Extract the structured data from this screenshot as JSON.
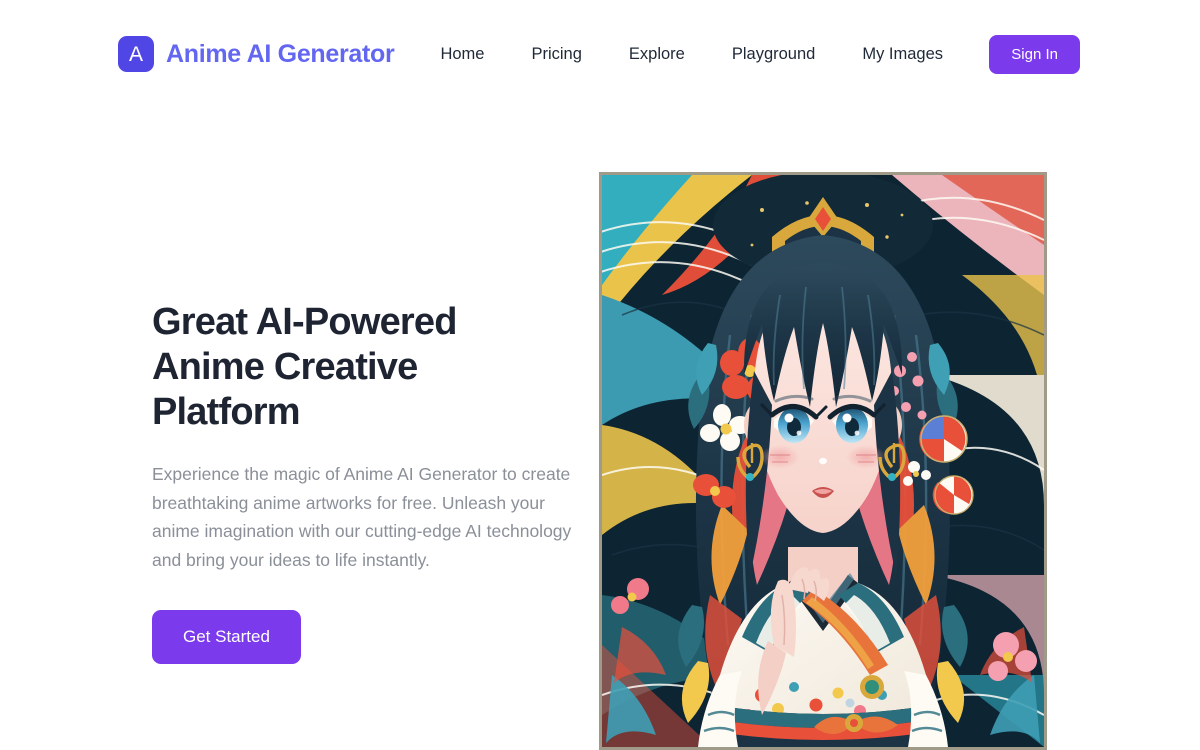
{
  "header": {
    "logo_icon": "letter-a-badge-icon",
    "logo_letter": "A",
    "brand_name": "Anime AI Generator",
    "nav_items": [
      {
        "label": "Home"
      },
      {
        "label": "Pricing"
      },
      {
        "label": "Explore"
      },
      {
        "label": "Playground"
      },
      {
        "label": "My Images"
      }
    ],
    "signin_label": "Sign In"
  },
  "hero": {
    "title": "Great AI-Powered Anime Creative Platform",
    "description": "Experience the magic of Anime AI Generator to create breathtaking anime artworks for free. Unleash your anime imagination with our cutting-edge AI technology and bring your ideas to life instantly.",
    "cta_label": "Get Started",
    "image_alt": "anime-girl-kimono-illustration"
  },
  "colors": {
    "brand_indigo": "#6366f1",
    "logo_badge": "#4f46e5",
    "accent_purple": "#7c3aed",
    "heading": "#1e2432",
    "body_text": "#8a8f98",
    "nav_text": "#1f2937",
    "background": "#ffffff",
    "image_frame": "#a09a88"
  }
}
